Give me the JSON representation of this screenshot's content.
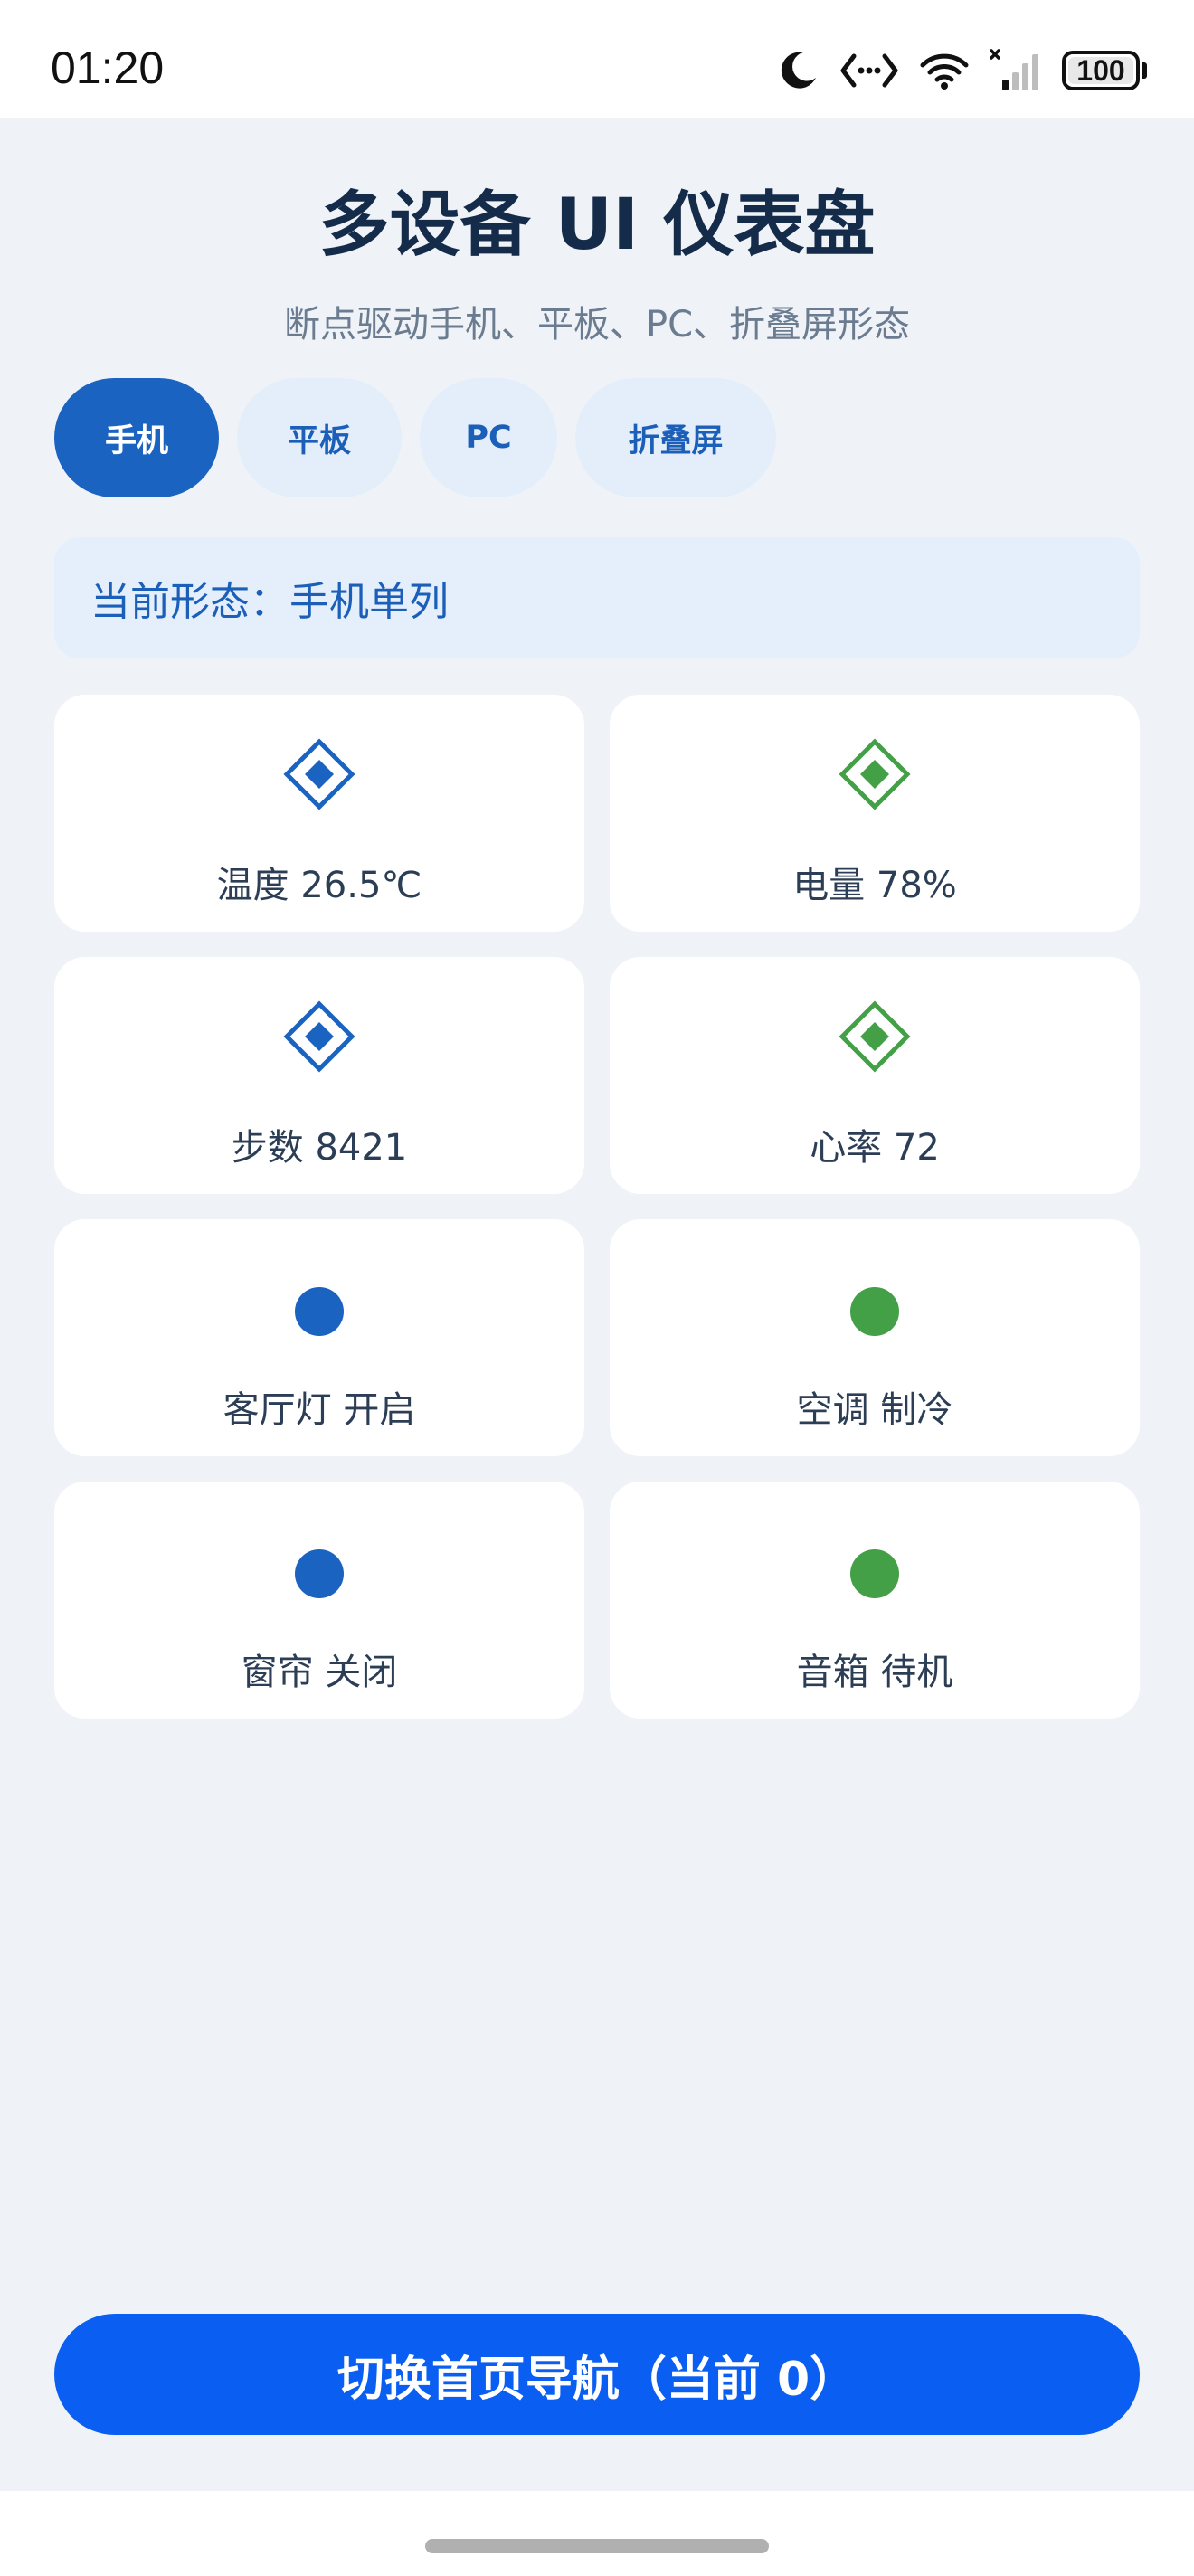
{
  "status_bar": {
    "time": "01:20",
    "battery": "100",
    "icons": [
      "moon-icon",
      "code-arrows-icon",
      "wifi-icon",
      "signal-icon",
      "battery-icon"
    ]
  },
  "header": {
    "title": "多设备 UI 仪表盘",
    "subtitle": "断点驱动手机、平板、PC、折叠屏形态"
  },
  "tabs": [
    {
      "label": "手机",
      "active": true
    },
    {
      "label": "平板",
      "active": false
    },
    {
      "label": "PC",
      "active": false
    },
    {
      "label": "折叠屏",
      "active": false
    }
  ],
  "mode_banner": {
    "text": "当前形态：手机单列"
  },
  "cards": [
    {
      "label": "温度 26.5℃",
      "icon": "diamond-icon",
      "color": "#1b63c0"
    },
    {
      "label": "电量 78%",
      "icon": "diamond-icon",
      "color": "#43a047"
    },
    {
      "label": "步数 8421",
      "icon": "diamond-icon",
      "color": "#1b63c0"
    },
    {
      "label": "心率 72",
      "icon": "diamond-icon",
      "color": "#43a047"
    },
    {
      "label": "客厅灯 开启",
      "icon": "dot-icon",
      "color": "#1b63c0"
    },
    {
      "label": "空调 制冷",
      "icon": "dot-icon",
      "color": "#43a047"
    },
    {
      "label": "窗帘 关闭",
      "icon": "dot-icon",
      "color": "#1b63c0"
    },
    {
      "label": "音箱 待机",
      "icon": "dot-icon",
      "color": "#43a047"
    }
  ],
  "nav_button": {
    "label": "切换首页导航（当前 0）"
  },
  "colors": {
    "primary": "#1b63c0",
    "green": "#43a047",
    "button": "#0a5ff2",
    "background": "#eff3f8"
  }
}
